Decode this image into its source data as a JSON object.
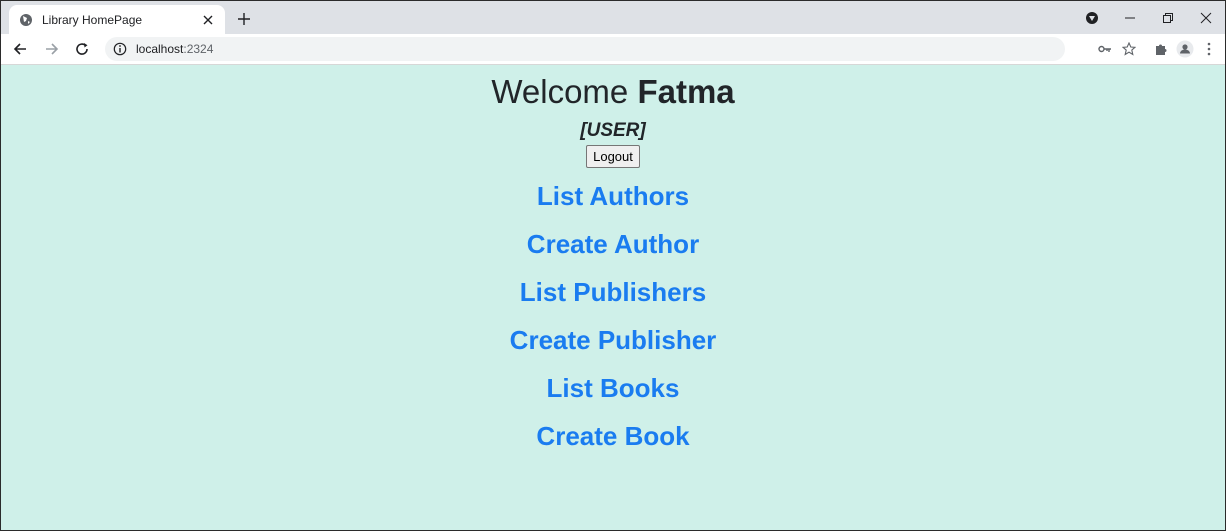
{
  "browser": {
    "tab_title": "Library HomePage",
    "url_host": "localhost",
    "url_port": ":2324"
  },
  "page": {
    "welcome_prefix": "Welcome",
    "user_name": "Fatma",
    "role": "[USER]",
    "logout_label": "Logout",
    "links": [
      {
        "label": "List Authors"
      },
      {
        "label": "Create Author"
      },
      {
        "label": "List Publishers"
      },
      {
        "label": "Create Publisher"
      },
      {
        "label": "List Books"
      },
      {
        "label": "Create Book"
      }
    ]
  },
  "colors": {
    "page_background": "#cff0e9",
    "link": "#1a7cf0",
    "heading": "#212529"
  }
}
